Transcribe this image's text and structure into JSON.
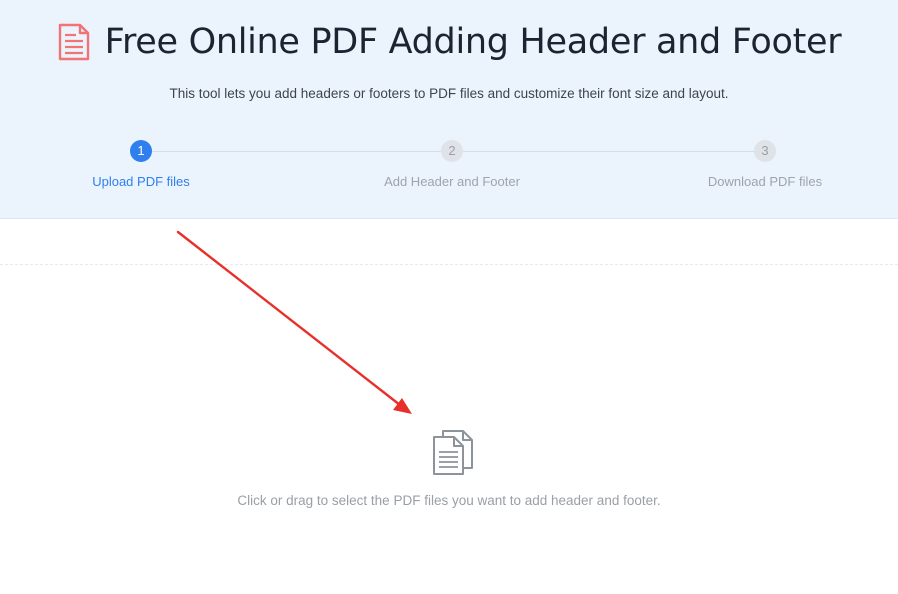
{
  "header": {
    "title": "Free Online PDF Adding Header and Footer",
    "subtitle": "This tool lets you add headers or footers to PDF files and customize their font size and layout.",
    "icon": "pdf-document-icon",
    "icon_color": "#f07474"
  },
  "steps": [
    {
      "number": "1",
      "label": "Upload PDF files",
      "state": "active"
    },
    {
      "number": "2",
      "label": "Add Header and Footer",
      "state": "inactive"
    },
    {
      "number": "3",
      "label": "Download PDF files",
      "state": "inactive"
    }
  ],
  "upload": {
    "icon": "files-icon",
    "hint": "Click or drag to select the PDF files you want to add header and footer."
  },
  "annotation": {
    "type": "arrow",
    "color": "#e8302a"
  },
  "colors": {
    "accent": "#2f7fef",
    "hero_background": "#ebf3fd"
  }
}
